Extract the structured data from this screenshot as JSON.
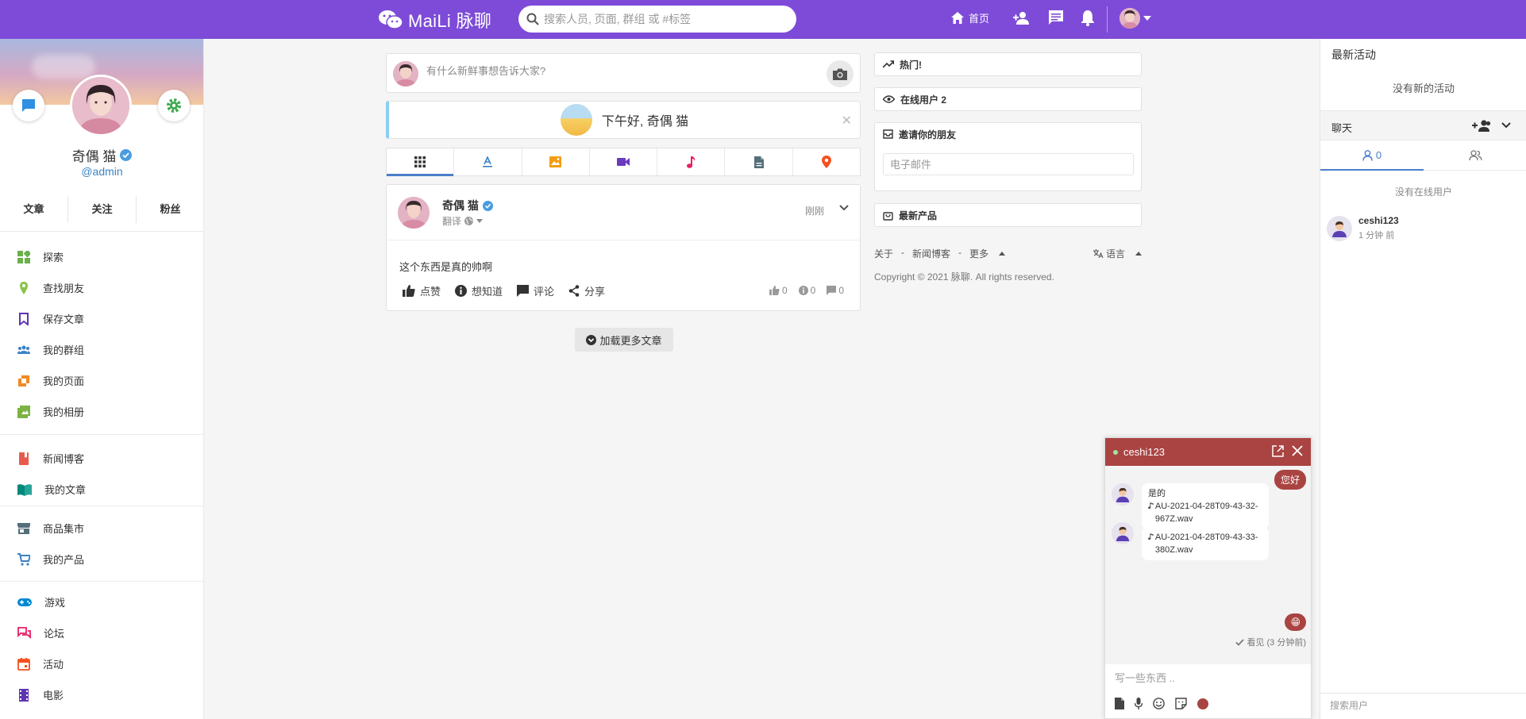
{
  "header": {
    "logo_text": "MaiLi 脉聊",
    "search_placeholder": "搜索人员, 页面, 群组 或 #标签",
    "home_label": "首页"
  },
  "sidebar": {
    "user_name": "奇偶 猫",
    "user_handle": "@admin",
    "stats": [
      "文章",
      "关注",
      "粉丝"
    ],
    "menu_group1": [
      {
        "label": "探索",
        "icon": "explore-icon",
        "color": "#6ab04c"
      },
      {
        "label": "查找朋友",
        "icon": "location-pin-icon",
        "color": "#8bc34a"
      },
      {
        "label": "保存文章",
        "icon": "bookmark-icon",
        "color": "#5e35b1"
      },
      {
        "label": "我的群组",
        "icon": "group-icon",
        "color": "#3b82c4"
      },
      {
        "label": "我的页面",
        "icon": "flag-icon",
        "color": "#f08a24"
      },
      {
        "label": "我的相册",
        "icon": "album-icon",
        "color": "#7cb342"
      }
    ],
    "menu_group2": [
      {
        "label": "新闻博客",
        "icon": "bookmark-book-icon",
        "color": "#e85a4f"
      },
      {
        "label": "我的文章",
        "icon": "open-book-icon",
        "color": "#00897b"
      }
    ],
    "menu_group3": [
      {
        "label": "商品集市",
        "icon": "store-icon",
        "color": "#546e7a"
      },
      {
        "label": "我的产品",
        "icon": "cart-icon",
        "color": "#3b82c4"
      }
    ],
    "menu_group4": [
      {
        "label": "游戏",
        "icon": "gamepad-icon",
        "color": "#0288d1"
      },
      {
        "label": "论坛",
        "icon": "forum-icon",
        "color": "#e91e63"
      },
      {
        "label": "活动",
        "icon": "calendar-icon",
        "color": "#f4511e"
      },
      {
        "label": "电影",
        "icon": "film-icon",
        "color": "#5e35b1"
      }
    ]
  },
  "composer": {
    "placeholder": "有什么新鲜事想告诉大家?"
  },
  "greeting": {
    "text": "下午好, 奇偶 猫"
  },
  "post_tabs": [
    {
      "icon": "grid-icon",
      "color": "#333333"
    },
    {
      "icon": "text-icon",
      "color": "#3b82c4"
    },
    {
      "icon": "image-icon",
      "color": "#f39c12"
    },
    {
      "icon": "video-icon",
      "color": "#6a3bbd"
    },
    {
      "icon": "music-icon",
      "color": "#e91e63"
    },
    {
      "icon": "file-icon",
      "color": "#546e7a"
    },
    {
      "icon": "location-icon",
      "color": "#f4511e"
    }
  ],
  "post": {
    "author": "奇偶 猫",
    "translate": "翻译",
    "time": "刚刚",
    "text": "这个东西是真的帅啊",
    "actions": [
      "点赞",
      "想知道",
      "评论",
      "分享"
    ],
    "counts": {
      "likes": "0",
      "wonders": "0",
      "comments": "0"
    }
  },
  "load_more": "加载更多文章",
  "widgets": {
    "trending": "热门!",
    "online": "在线用户 2",
    "invite_title": "邀请你的朋友",
    "invite_placeholder": "电子邮件",
    "products": "最新产品"
  },
  "footer": {
    "about": "关于",
    "blog": "新闻博客",
    "more": "更多",
    "language": "语言",
    "copyright": "Copyright © 2021 脉聊. All rights reserved.",
    "sep": "-"
  },
  "right_panel": {
    "activity_title": "最新活动",
    "no_activity": "没有新的活动",
    "chat_label": "聊天",
    "online_count": "0",
    "no_online": "没有在线用户",
    "user": {
      "name": "ceshi123",
      "time": "1 分钟 前"
    },
    "search_placeholder": "搜索用户"
  },
  "chat_window": {
    "name": "ceshi123",
    "messages": [
      {
        "side": "right",
        "text": "您好"
      },
      {
        "side": "left",
        "text": "是的",
        "file": "AU-2021-04-28T09-43-32-967Z.wav"
      },
      {
        "side": "left",
        "file": "AU-2021-04-28T09-43-33-380Z.wav"
      },
      {
        "side": "right",
        "emoji": "😁"
      }
    ],
    "seen": "看见 (3 分钟前)",
    "input_placeholder": "写一些东西 ..",
    "header_color": "#a94442"
  }
}
